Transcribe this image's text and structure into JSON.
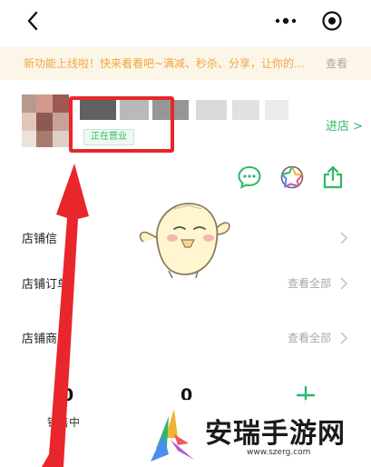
{
  "notice": {
    "text": "新功能上线啦！快来看看吧~满减、秒杀、分享，让你的…",
    "link": "查看"
  },
  "store": {
    "status": "正在营业",
    "enter_label": "进店 >"
  },
  "icons": {
    "back": "back-chevron-icon",
    "more": "more-dots-icon",
    "target": "target-icon",
    "chat": "chat-bubble-icon",
    "aperture": "aperture-icon",
    "share": "share-icon"
  },
  "rows": [
    {
      "label": "店铺信",
      "right": ""
    },
    {
      "label": "店铺订单",
      "right": "查看全部"
    },
    {
      "label": "店铺商品",
      "right": "查看全部"
    }
  ],
  "stats": [
    {
      "value": "0",
      "label": "销售中"
    },
    {
      "value": "0",
      "label": ""
    }
  ],
  "watermark": {
    "title": "安瑞手游网",
    "url": "www.szerg.com"
  },
  "colors": {
    "accent_green": "#2fb866",
    "notice_text": "#f0a640",
    "notice_bg": "#fcf6e8",
    "highlight_red": "#e8262c"
  }
}
